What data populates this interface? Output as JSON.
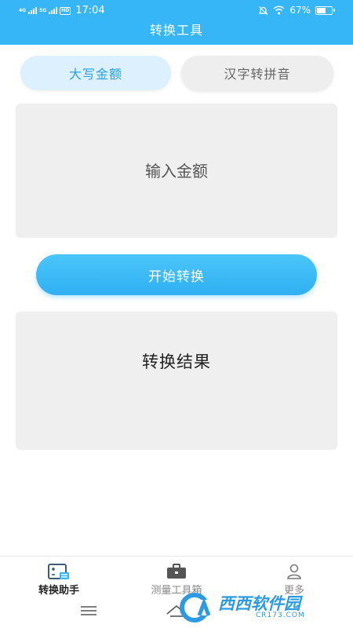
{
  "status_bar": {
    "network_tags": [
      "4G",
      "5G"
    ],
    "hd_label": "HD",
    "time": "17:04",
    "battery_percent": "67%",
    "battery_level": 0.67,
    "icons": [
      "mute-icon",
      "wifi-icon",
      "battery-icon"
    ]
  },
  "app": {
    "title": "转换工具"
  },
  "tabs": [
    {
      "label": "大写金额",
      "active": true
    },
    {
      "label": "汉字转拼音",
      "active": false
    }
  ],
  "input": {
    "placeholder": "输入金额",
    "value": ""
  },
  "convert_button": {
    "label": "开始转换"
  },
  "result": {
    "text": "转换结果"
  },
  "bottom_nav": {
    "items": [
      {
        "label": "转换助手",
        "icon": "convert-assistant-icon",
        "active": true
      },
      {
        "label": "测量工具箱",
        "icon": "toolbox-icon",
        "active": false
      },
      {
        "label": "更多",
        "icon": "person-icon",
        "active": false
      }
    ]
  },
  "system_nav": {
    "icons": [
      "menu-icon",
      "home-icon",
      "back-icon"
    ]
  },
  "watermark": {
    "text": "西西软件园",
    "url": "CR173.COM"
  },
  "colors": {
    "primary": "#36B6F6",
    "tab_active_bg": "#DCF0FD",
    "tab_active_text": "#2AA2E6",
    "panel_bg": "#EFEFEF"
  }
}
